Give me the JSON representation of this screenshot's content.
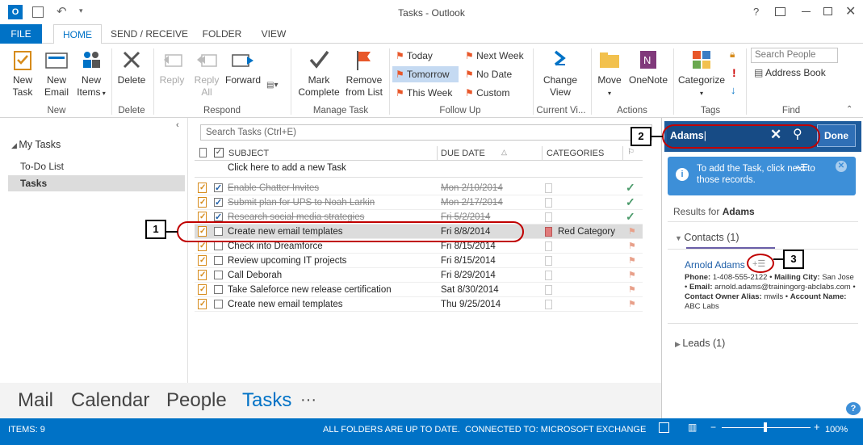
{
  "window": {
    "title": "Tasks - Outlook"
  },
  "tabs": [
    "FILE",
    "HOME",
    "SEND / RECEIVE",
    "FOLDER",
    "VIEW"
  ],
  "ribbon": {
    "new_task": "New\nTask",
    "new_email": "New\nEmail",
    "new_items": "New\nItems",
    "group_new": "New",
    "delete": "Delete",
    "group_delete": "Delete",
    "reply": "Reply",
    "reply_all": "Reply\nAll",
    "forward": "Forward",
    "group_respond": "Respond",
    "mark_complete": "Mark\nComplete",
    "remove_from_list": "Remove\nfrom List",
    "group_manage": "Manage Task",
    "today": "Today",
    "tomorrow": "Tomorrow",
    "this_week": "This Week",
    "next_week": "Next Week",
    "no_date": "No Date",
    "custom": "Custom",
    "group_follow": "Follow Up",
    "change_view": "Change\nView",
    "group_current": "Current Vi...",
    "move": "Move",
    "onenote": "OneNote",
    "group_actions": "Actions",
    "categorize": "Categorize",
    "group_tags": "Tags",
    "search_people": "Search People",
    "address_book": "Address Book",
    "group_find": "Find"
  },
  "sidebar": {
    "heading": "My Tasks",
    "items": [
      "To-Do List",
      "Tasks"
    ]
  },
  "tasklist": {
    "search_placeholder": "Search Tasks (Ctrl+E)",
    "col_subject": "SUBJECT",
    "col_due": "DUE DATE",
    "col_categories": "CATEGORIES",
    "add_new": "Click here to add a new Task",
    "rows": [
      {
        "subject": "Enable Chatter Invites",
        "due": "Mon 2/10/2014",
        "category": "",
        "done": true
      },
      {
        "subject": "Submit plan for UPS to Noah Larkin",
        "due": "Mon 2/17/2014",
        "category": "",
        "done": true
      },
      {
        "subject": "Research social media strategies",
        "due": "Fri 5/2/2014",
        "category": "",
        "done": true
      },
      {
        "subject": "Create new email templates",
        "due": "Fri 8/8/2014",
        "category": "Red Category",
        "done": false
      },
      {
        "subject": "Check into Dreamforce",
        "due": "Fri 8/15/2014",
        "category": "",
        "done": false
      },
      {
        "subject": "Review upcoming IT projects",
        "due": "Fri 8/15/2014",
        "category": "",
        "done": false
      },
      {
        "subject": "Call Deborah",
        "due": "Fri 8/29/2014",
        "category": "",
        "done": false
      },
      {
        "subject": "Take Saleforce new release certification",
        "due": "Sat 8/30/2014",
        "category": "",
        "done": false
      },
      {
        "subject": "Create new email templates",
        "due": "Thu 9/25/2014",
        "category": "",
        "done": false
      }
    ]
  },
  "nav": {
    "mail": "Mail",
    "calendar": "Calendar",
    "people": "People",
    "tasks": "Tasks",
    "more": "···"
  },
  "status": {
    "items": "ITEMS: 9",
    "sync": "ALL FOLDERS ARE UP TO DATE.",
    "connected": "CONNECTED TO: MICROSOFT EXCHANGE",
    "zoom": "100%"
  },
  "right_pane": {
    "search_value": "Adams",
    "done": "Done",
    "info": "To add the Task, click  next to those records.",
    "results_label": "Results for",
    "results_term": "Adams",
    "contacts_header": "Contacts (1)",
    "contact_name": "Arnold Adams",
    "phone_label": "Phone:",
    "phone": "1-408-555-2122",
    "city_label": "Mailing City:",
    "city": "San Jose",
    "email_label": "Email:",
    "email": "arnold.adams@trainingorg-abclabs.com",
    "owner_label": "Contact Owner Alias:",
    "owner": "mwils",
    "account_label": "Account Name:",
    "account": "ABC Labs",
    "leads_header": "Leads (1)"
  },
  "callouts": [
    "1",
    "2",
    "3"
  ],
  "colors": {
    "accent": "#0072c6",
    "pane_header": "#1e5b9c",
    "red_oval": "#c00000"
  }
}
